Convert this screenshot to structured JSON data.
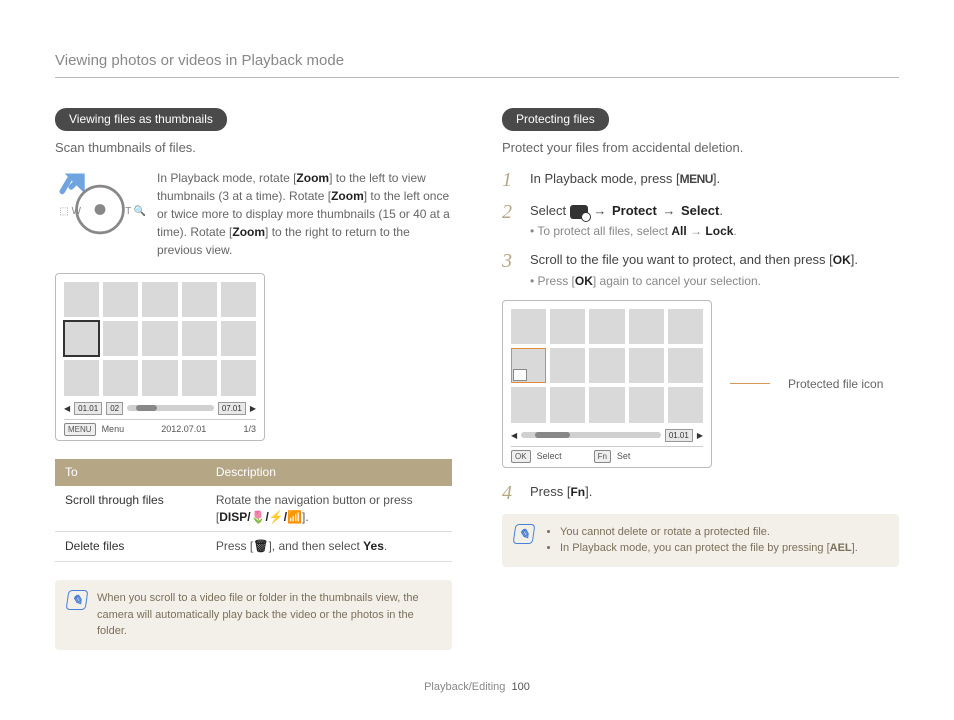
{
  "header": "Viewing photos or videos in Playback mode",
  "left": {
    "section_title": "Viewing files as thumbnails",
    "lead": "Scan thumbnails of files.",
    "dial_para_1": "In Playback mode, rotate [",
    "zoom": "Zoom",
    "dial_para_2": "] to the left to view thumbnails (3 at a time). Rotate [",
    "dial_para_3": "] to the left once or twice more to display more thumbnails (15 or 40 at a time). Rotate [",
    "dial_para_4": "] to the right to return to the previous view.",
    "grid_bar": {
      "left_chip": "01.01",
      "left_chip2": "02",
      "mid_chip": "07.01"
    },
    "grid_footer": {
      "menu_btn": "MENU",
      "menu_lbl": "Menu",
      "date": "2012.07.01",
      "counter": "1/3"
    },
    "table": {
      "th1": "To",
      "th2": "Description",
      "rows": [
        {
          "to": "Scroll through files",
          "desc_1": "Rotate the navigation button or press [",
          "desc_btns": "DISP/🌷/⚡/📶",
          "desc_2": "]."
        },
        {
          "to": "Delete files",
          "desc_1": "Press [",
          "desc_btns": "🗑",
          "desc_2": "], and then select ",
          "desc_bold": "Yes",
          "desc_3": "."
        }
      ]
    },
    "note": "When you scroll to a video file or folder in the thumbnails view, the camera will automatically play back the video or the photos in the folder."
  },
  "right": {
    "section_title": "Protecting files",
    "lead": "Protect your files from accidental deletion.",
    "steps": [
      {
        "num": "1",
        "main_1": "In Playback mode, press [",
        "main_btn": "MENU",
        "main_2": "]."
      },
      {
        "num": "2",
        "main_1": "Select ",
        "icon": true,
        "arrow1": " → ",
        "bold1": "Protect",
        "arrow2": " → ",
        "bold2": "Select",
        "main_2": ".",
        "sub_1": "To protect all files, select ",
        "sub_bold1": "All",
        "sub_arrow": " → ",
        "sub_bold2": "Lock",
        "sub_2": "."
      },
      {
        "num": "3",
        "main_1": "Scroll to the file you want to protect, and then press [",
        "main_btn": "OK",
        "main_2": "].",
        "sub_1": "Press [",
        "sub_btn": "OK",
        "sub_2": "] again to cancel your selection."
      },
      {
        "num": "4",
        "main_1": "Press [",
        "main_btn": "Fn",
        "main_2": "]."
      }
    ],
    "grid_bar": {
      "chip": "01.01"
    },
    "grid_footer": {
      "ok_btn": "OK",
      "ok_lbl": "Select",
      "fn_btn": "Fn",
      "fn_lbl": "Set"
    },
    "callout": "Protected file icon",
    "note_items": [
      "You cannot delete or rotate a protected file.",
      "In Playback mode, you can protect the file by pressing [AEL]."
    ],
    "note_ael": "AEL"
  },
  "footer": {
    "section": "Playback/Editing",
    "page": "100"
  }
}
